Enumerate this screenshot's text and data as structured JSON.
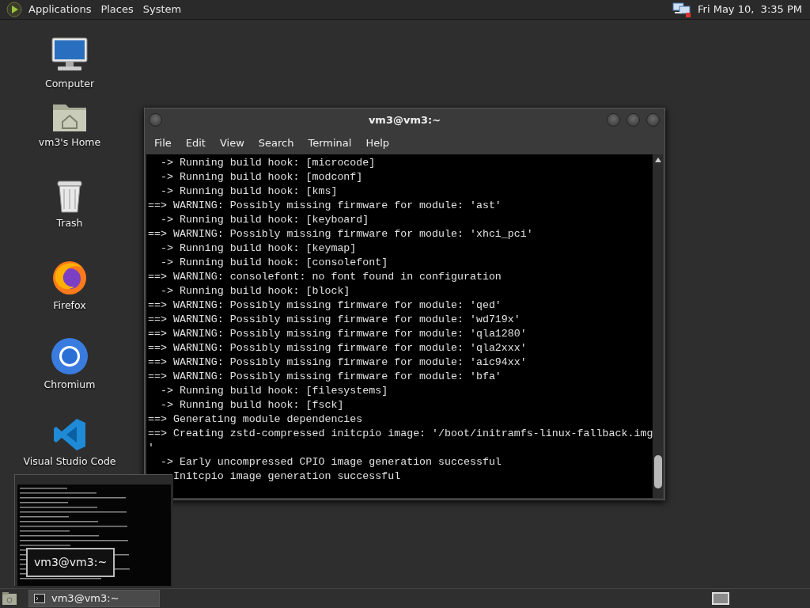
{
  "top_panel": {
    "menus": [
      "Applications",
      "Places",
      "System"
    ],
    "clock": "Fri May 10,  3:35 PM"
  },
  "desktop_icons": [
    {
      "label": "Computer",
      "kind": "computer"
    },
    {
      "label": "vm3's Home",
      "kind": "home"
    },
    {
      "label": "Trash",
      "kind": "trash"
    },
    {
      "label": "Firefox",
      "kind": "firefox"
    },
    {
      "label": "Chromium",
      "kind": "chromium"
    },
    {
      "label": "Visual Studio Code",
      "kind": "code"
    }
  ],
  "terminal": {
    "title": "vm3@vm3:~",
    "menu": [
      "File",
      "Edit",
      "View",
      "Search",
      "Terminal",
      "Help"
    ],
    "lines": [
      "  -> Running build hook: [microcode]",
      "  -> Running build hook: [modconf]",
      "  -> Running build hook: [kms]",
      "==> WARNING: Possibly missing firmware for module: 'ast'",
      "  -> Running build hook: [keyboard]",
      "==> WARNING: Possibly missing firmware for module: 'xhci_pci'",
      "  -> Running build hook: [keymap]",
      "  -> Running build hook: [consolefont]",
      "==> WARNING: consolefont: no font found in configuration",
      "  -> Running build hook: [block]",
      "==> WARNING: Possibly missing firmware for module: 'qed'",
      "==> WARNING: Possibly missing firmware for module: 'wd719x'",
      "==> WARNING: Possibly missing firmware for module: 'qla1280'",
      "==> WARNING: Possibly missing firmware for module: 'qla2xxx'",
      "==> WARNING: Possibly missing firmware for module: 'aic94xx'",
      "==> WARNING: Possibly missing firmware for module: 'bfa'",
      "  -> Running build hook: [filesystems]",
      "  -> Running build hook: [fsck]",
      "==> Generating module dependencies",
      "==> Creating zstd-compressed initcpio image: '/boot/initramfs-linux-fallback.img",
      "'",
      "  -> Early uncompressed CPIO image generation successful",
      "    Initcpio image generation successful"
    ]
  },
  "preview": {
    "tooltip": "vm3@vm3:~"
  },
  "taskbar": {
    "tasks": [
      "vm3@vm3:~"
    ]
  }
}
